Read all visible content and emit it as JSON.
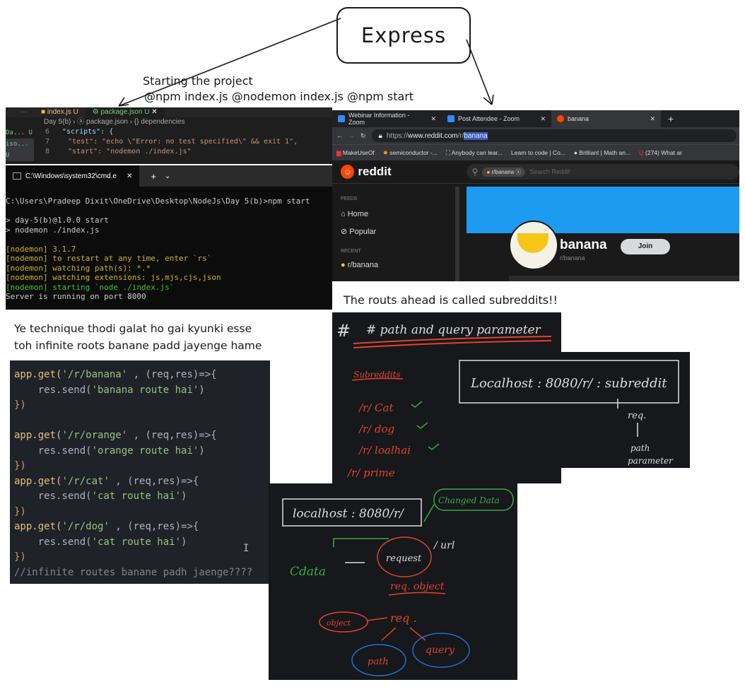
{
  "express_title": "Express",
  "notes": {
    "starting_line1": "Starting the project",
    "starting_line2": "@npm index.js @nodemon index.js @npm start",
    "technique_line1": "Ye technique thodi galat ho gai kyunki esse",
    "technique_line2": "toh infinite roots banane padd jayenge hame",
    "routes": "The routs ahead is called subreddits!!"
  },
  "vscode": {
    "tab1": "index.js",
    "tab1_status": "U",
    "tab2": "package.json",
    "tab2_status": "U",
    "close_icon": "✕",
    "more": "···",
    "breadcrumb": "Day 5(b) › ⓐ package.json › {} dependencies",
    "side1": "Da... U",
    "side2": "iso... U",
    "lines": [
      {
        "num": "6",
        "text": "\"scripts\": {"
      },
      {
        "num": "7",
        "text": "\"test\": \"echo \\\"Error: no test specified\\\" && exit 1\","
      },
      {
        "num": "8",
        "text": "\"start\": \"nodemon ./index.js\""
      }
    ]
  },
  "cmd": {
    "tab_title": "C:\\Windows\\system32\\cmd.e",
    "close": "✕",
    "plus": "+",
    "chevron": "⌄",
    "lines": [
      "C:\\Users\\Pradeep Dixit\\OneDrive\\Desktop\\NodeJs\\Day 5(b)>npm start",
      "",
      "> day-5(b)@1.0.0 start",
      "> nodemon ./index.js",
      ""
    ],
    "yellow_lines": [
      "[nodemon] 3.1.7",
      "[nodemon] to restart at any time, enter `rs`",
      "[nodemon] watching path(s): *.*",
      "[nodemon] watching extensions: js,mjs,cjs,json"
    ],
    "green_line": "[nodemon] starting `node ./index.js`",
    "last_line": "Server is running on port 8000"
  },
  "browser": {
    "tabs": [
      "Webinar Information - Zoom",
      "Post Attendee - Zoom",
      "banana"
    ],
    "new_tab": "+",
    "url_prefix": "https://",
    "url_domain": "www.reddit.com",
    "url_path": "/r/",
    "url_selected": "banana",
    "bookmarks": [
      "MakeUseOf",
      "semiconductor -...",
      "Anybody can lear...",
      "Learn to code | Co...",
      "Brilliant | Math an...",
      "(274) What ar"
    ],
    "logo": "reddit",
    "search_chip": "r/banana",
    "search_placeholder": "Search Reddit",
    "feeds_label": "FEEDS",
    "home": "Home",
    "popular": "Popular",
    "recent_label": "RECENT",
    "recent_item": "r/banana",
    "sub_name": "banana",
    "sub_handle": "r/banana",
    "join": "Join",
    "colors": {
      "reddit_orange": "#ff4500",
      "banner_blue": "#1d9bf0"
    }
  },
  "code": {
    "lines": [
      {
        "path": "'/r/banana'",
        "msg": "'banana route hai'"
      },
      {
        "path": "'/r/orange'",
        "msg": "'orange route hai'"
      },
      {
        "path": "'/r/cat'",
        "msg": "'cat route hai'"
      },
      {
        "path": "'/r/dog'",
        "msg": "'cat route hai'"
      }
    ],
    "app_get": "app.get(",
    "params": " , (req,res)=>{",
    "send": "    res.send(",
    "close_paren": ")",
    "close_block": "})",
    "comment": "//infinite routes banane padh jaenge????"
  },
  "board1": {
    "heading": "# path and query parameter",
    "subreddits": "Subreddits",
    "items": [
      "/r/ Cat",
      "/r/ dog",
      "/r/ loalhai",
      "/r/ prime"
    ]
  },
  "board2": {
    "box": "Localhost : 8080/r/ : subreddit",
    "req": "req.",
    "path_param_1": "path",
    "path_param_2": "parameter"
  },
  "board3": {
    "box": "localhost : 8080/r/",
    "changed": "Changed Data",
    "cdata": "Cdata",
    "request": "request",
    "url": "/ url",
    "reqobject": "req. object",
    "object": "object",
    "req": "req .",
    "path": "path",
    "query": "query"
  }
}
